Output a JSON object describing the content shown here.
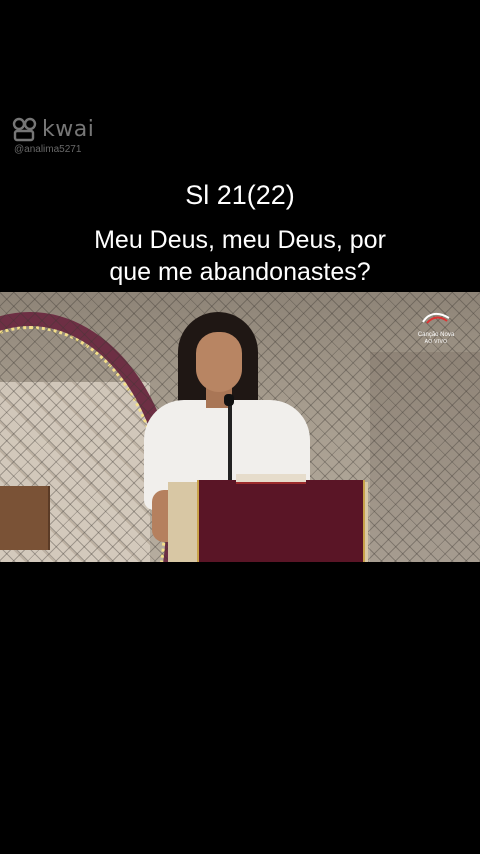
{
  "watermark": {
    "brand": "kwai",
    "username": "@analima5271",
    "logo_icon": "kwai-logo-icon"
  },
  "caption": {
    "reference": "Sl 21(22)",
    "line1": "Meu Deus, meu Deus, por",
    "line2": "que me abandonastes?"
  },
  "video": {
    "channel_name": "Canção Nova",
    "live_label": "AO VIVO",
    "channel_icon": "cancao-nova-logo-icon"
  }
}
